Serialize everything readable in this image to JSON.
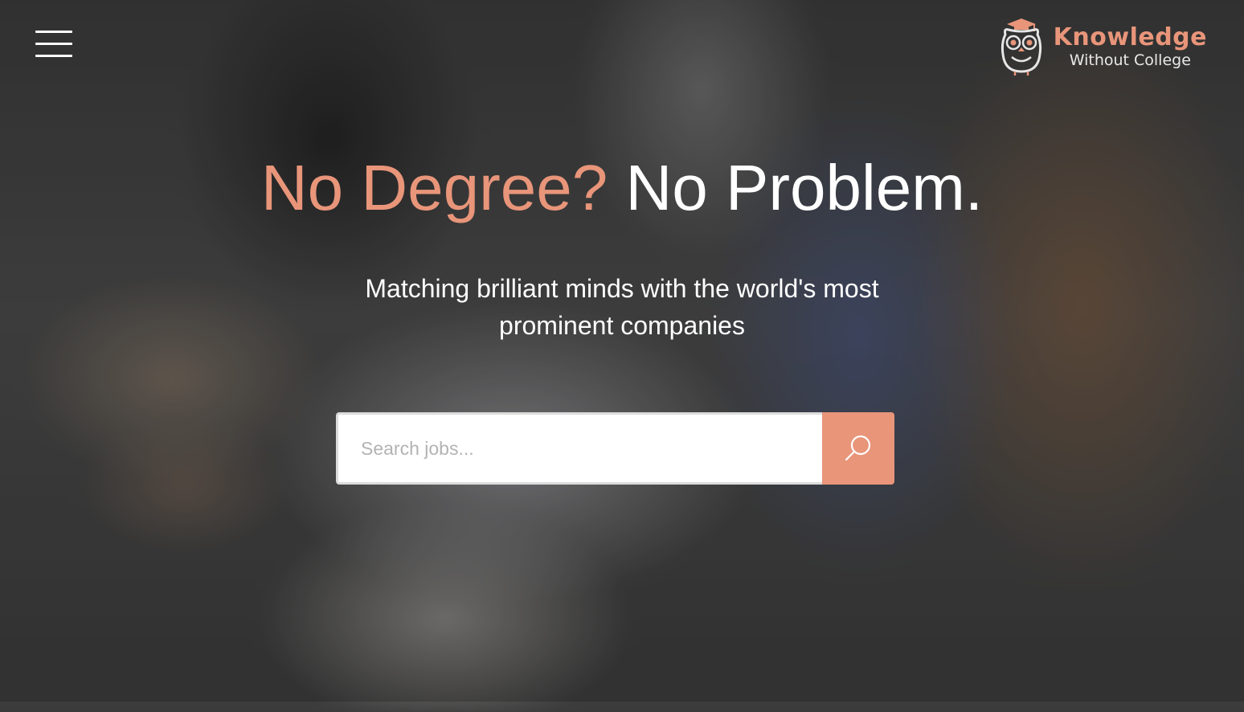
{
  "header": {
    "menu_icon": "hamburger-menu-icon",
    "logo": {
      "icon": "owl-graduation-icon",
      "title": "Knowledge",
      "subtitle": "Without College"
    }
  },
  "hero": {
    "title_accent": "No Degree?",
    "title_rest": "No Problem.",
    "subtitle": "Matching brilliant minds with the world's most prominent companies"
  },
  "search": {
    "placeholder": "Search jobs...",
    "value": "",
    "button_icon": "search-icon"
  },
  "colors": {
    "accent": "#e8957a",
    "text": "#ffffff"
  }
}
